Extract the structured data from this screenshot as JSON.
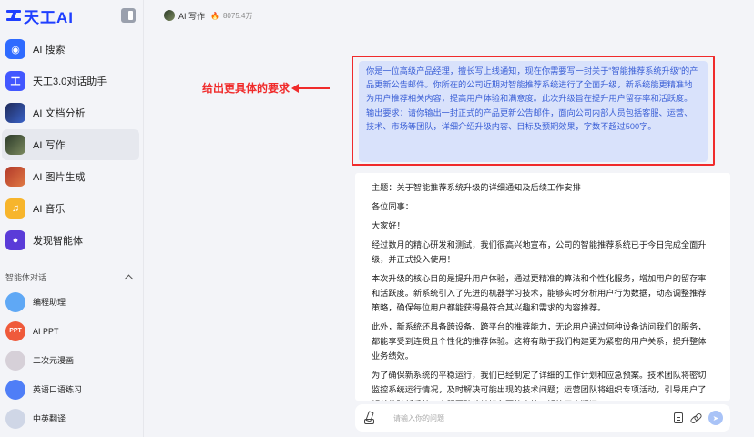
{
  "app": {
    "logo_text": "天工AI"
  },
  "sidebar": {
    "items": [
      {
        "label": "AI 搜索",
        "glyph": "◉"
      },
      {
        "label": "天工3.0对话助手",
        "glyph": "工"
      },
      {
        "label": "AI 文档分析",
        "glyph": ""
      },
      {
        "label": "AI 写作",
        "glyph": ""
      },
      {
        "label": "AI 图片生成",
        "glyph": ""
      },
      {
        "label": "AI 音乐",
        "glyph": "♫"
      },
      {
        "label": "发现智能体",
        "glyph": "●"
      }
    ],
    "section_title": "智能体对话",
    "agents": [
      {
        "label": "编程助理",
        "glyph": ""
      },
      {
        "label": "AI PPT",
        "glyph": "PPT"
      },
      {
        "label": "二次元漫画",
        "glyph": ""
      },
      {
        "label": "英语口语练习",
        "glyph": ""
      },
      {
        "label": "中英翻译",
        "glyph": ""
      }
    ]
  },
  "header": {
    "title": "AI 写作",
    "heat_icon": "🔥",
    "heat_value": "8075.4万"
  },
  "annotation": {
    "text": "给出更具体的要求"
  },
  "user_message": {
    "para1": "你是一位高级产品经理，擅长写上线通知，现在你需要写一封关于“智能推荐系统升级”的产品更新公告邮件。你所在的公司近期对智能推荐系统进行了全面升级，新系统能更精准地为用户推荐相关内容，提高用户体验和满意度。此次升级旨在提升用户留存率和活跃度。",
    "para2": "输出要求：请你输出一封正式的产品更新公告邮件，面向公司内部人员包括客服、运营、技术、市场等团队，详细介绍升级内容、目标及预期效果，字数不超过500字。"
  },
  "answer": {
    "subject": "主题：关于智能推荐系统升级的详细通知及后续工作安排",
    "greeting": "各位同事：",
    "hello": "大家好！",
    "p1": "经过数月的精心研发和测试，我们很高兴地宣布，公司的智能推荐系统已于今日完成全面升级，并正式投入使用！",
    "p2": "本次升级的核心目的是提升用户体验，通过更精准的算法和个性化服务，增加用户的留存率和活跃度。新系统引入了先进的机器学习技术，能够实时分析用户行为数据，动态调整推荐策略，确保每位用户都能获得最符合其兴趣和需求的内容推荐。",
    "p3": "此外，新系统还具备跨设备、跨平台的推荐能力，无论用户通过何种设备访问我们的服务，都能享受到连贯且个性化的推荐体验。这将有助于我们构建更为紧密的用户关系，提升整体业务绩效。",
    "p4": "为了确保新系统的平稳运行，我们已经制定了详细的工作计划和应急预案。技术团队将密切监控系统运行情况，及时解决可能出现的技术问题；运营团队将组织专项活动，引导用户了解并体验新系统，客服团队将做好必要的支持，解答用户疑问。"
  },
  "input": {
    "placeholder": "请输入你的问题"
  },
  "colors": {
    "accent": "#1f3fff",
    "highlight": "#f02b2b",
    "bubble": "#d9e2fb"
  }
}
